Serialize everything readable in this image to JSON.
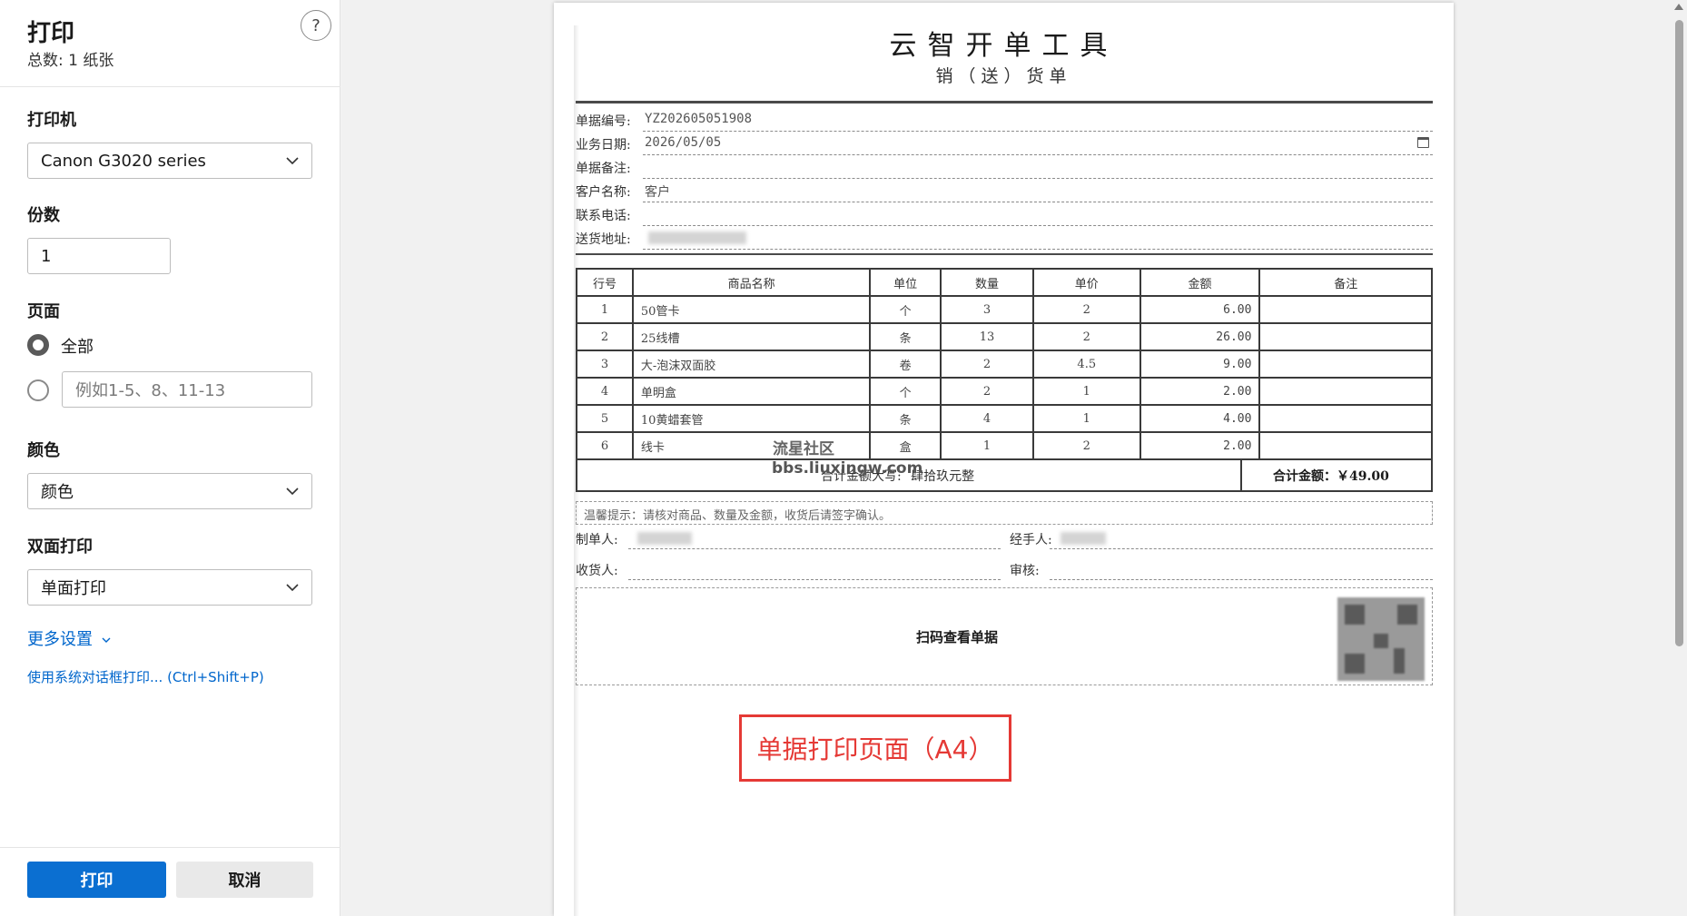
{
  "panel": {
    "title": "打印",
    "subtitle": "总数: 1 纸张",
    "help": "?",
    "printer_label": "打印机",
    "printer_value": "Canon G3020 series",
    "copies_label": "份数",
    "copies_value": "1",
    "pages_label": "页面",
    "pages_all": "全部",
    "pages_placeholder": "例如1-5、8、11-13",
    "color_label": "颜色",
    "color_value": "颜色",
    "duplex_label": "双面打印",
    "duplex_value": "单面打印",
    "more_settings": "更多设置",
    "system_dialog": "使用系统对话框打印... (Ctrl+Shift+P)",
    "print_button": "打印",
    "cancel_button": "取消"
  },
  "doc": {
    "title": "云智开单工具",
    "subtitle": "销（送）货单",
    "fields": [
      {
        "label": "单据编号:",
        "value": "YZ202605051908"
      },
      {
        "label": "业务日期:",
        "value": "2026/05/05"
      },
      {
        "label": "单据备注:",
        "value": ""
      },
      {
        "label": "客户名称:",
        "value": "客户"
      },
      {
        "label": "联系电话:",
        "value": ""
      },
      {
        "label": "送货地址:",
        "value": ""
      }
    ],
    "columns": [
      "行号",
      "商品名称",
      "单位",
      "数量",
      "单价",
      "金额",
      "备注"
    ],
    "rows": [
      [
        "1",
        "50管卡",
        "个",
        "3",
        "2",
        "6.00",
        ""
      ],
      [
        "2",
        "25线槽",
        "条",
        "13",
        "2",
        "26.00",
        ""
      ],
      [
        "3",
        "大-泡沫双面胶",
        "卷",
        "2",
        "4.5",
        "9.00",
        ""
      ],
      [
        "4",
        "单明盒",
        "个",
        "2",
        "1",
        "2.00",
        ""
      ],
      [
        "5",
        "10黄蜡套管",
        "条",
        "4",
        "1",
        "4.00",
        ""
      ],
      [
        "6",
        "线卡",
        "盒",
        "1",
        "2",
        "2.00",
        ""
      ]
    ],
    "total_upper_label": "合计金额大写:",
    "total_upper_value": "肆拾玖元整",
    "total_sum": "合计金额：￥49.00",
    "tip": "温馨提示：请核对商品、数量及金额，收货后请签字确认。",
    "maker_label": "制单人:",
    "handler_label": "经手人:",
    "receiver_label": "收货人:",
    "auditor_label": "审核:",
    "qr_text": "扫码查看单据"
  },
  "annotation": "单据打印页面（A4）",
  "watermark": {
    "line1": "流星社区",
    "line2": "bbs.liuxingw.com"
  },
  "colors": {
    "primary": "#0b6fd1",
    "link": "#0066cc",
    "annotation": "#e53935"
  }
}
